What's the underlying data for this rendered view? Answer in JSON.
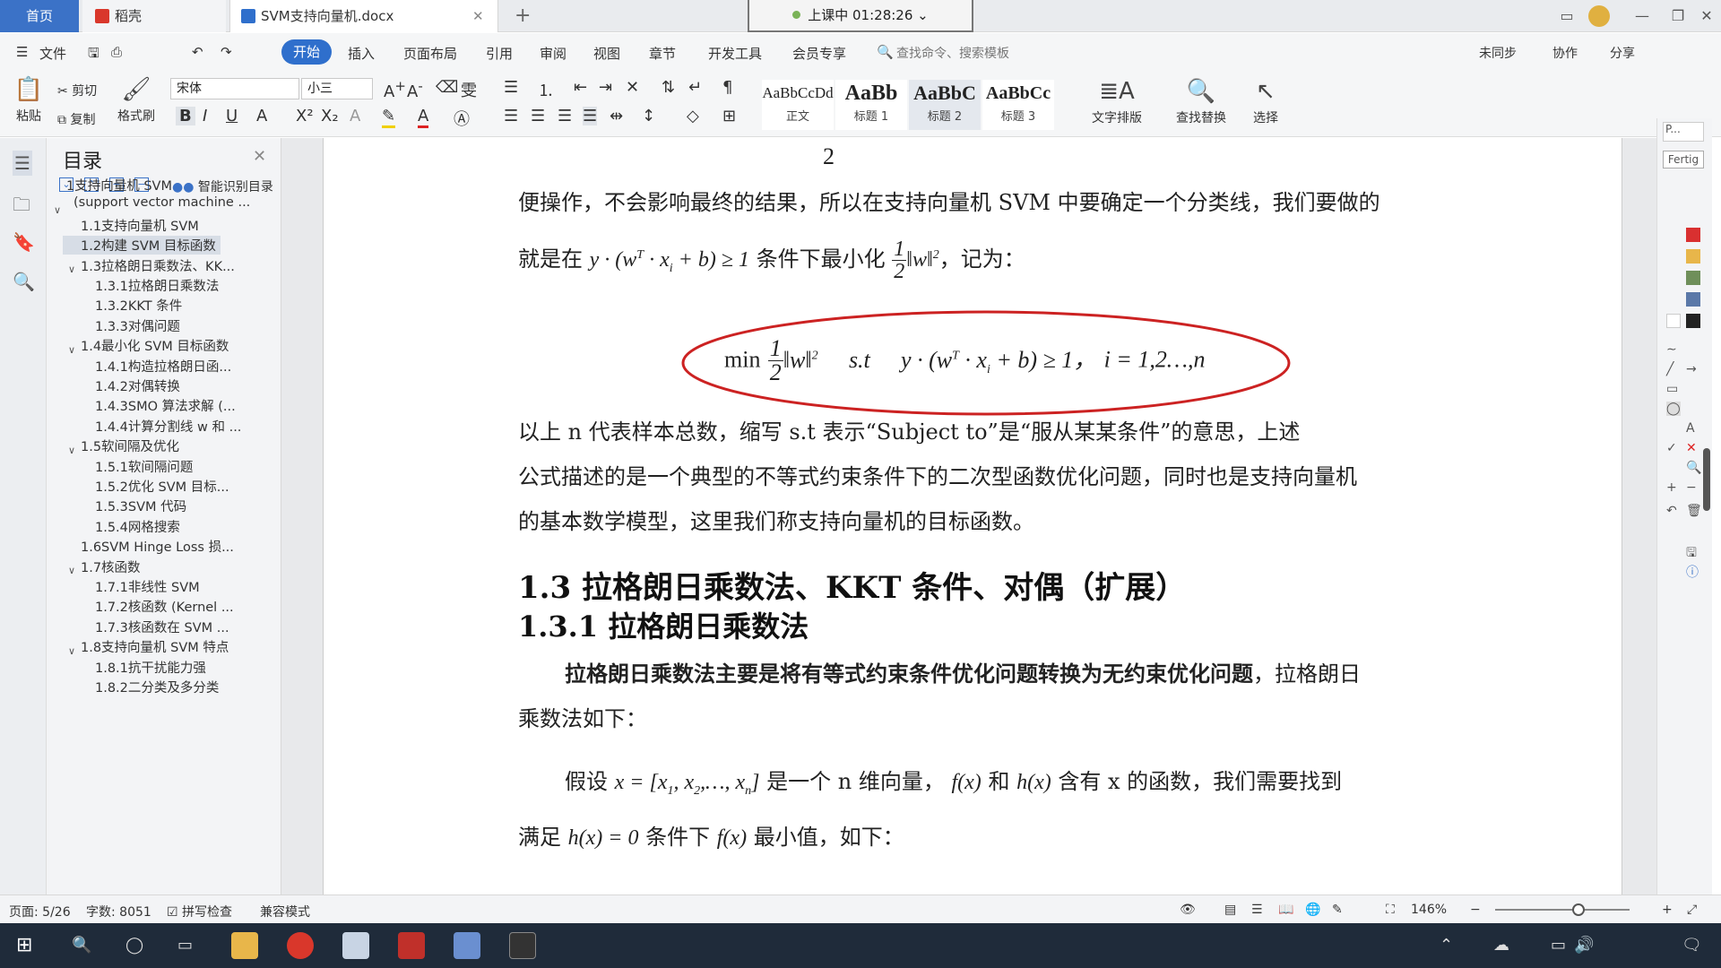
{
  "tabs": {
    "home": "首页",
    "daoke": "稻壳",
    "doc": "SVM支持向量机.docx",
    "add": "+"
  },
  "timer": "上课中 01:28:26",
  "menu": [
    "文件",
    "开始",
    "插入",
    "页面布局",
    "引用",
    "审阅",
    "视图",
    "章节",
    "开发工具",
    "会员专享"
  ],
  "search_placeholder": "查找命令、搜索模板",
  "right_menu": {
    "sync": "未同步",
    "collab": "协作",
    "share": "分享"
  },
  "ribbon": {
    "paste": "粘贴",
    "cut": "剪切",
    "copy": "复制",
    "format_painter": "格式刷",
    "font": "宋体",
    "size": "小三",
    "styles": [
      {
        "preview": "AaBbCcDd",
        "name": "正文"
      },
      {
        "preview": "AaBb",
        "name": "标题 1"
      },
      {
        "preview": "AaBbC",
        "name": "标题 2"
      },
      {
        "preview": "AaBbCc",
        "name": "标题 3"
      }
    ],
    "text_layout": "文字排版",
    "find_replace": "查找替换",
    "select": "选择"
  },
  "toc": {
    "title": "目录",
    "smart": "智能识别目录",
    "items": [
      "1支持向量机 SVM",
      "(support vector machine ...",
      "1.1支持向量机 SVM",
      "1.2构建 SVM 目标函数",
      "1.3拉格朗日乘数法、KK...",
      "1.3.1拉格朗日乘数法",
      "1.3.2KKT 条件",
      "1.3.3对偶问题",
      "1.4最小化 SVM 目标函数",
      "1.4.1构造拉格朗日函...",
      "1.4.2对偶转换",
      "1.4.3SMO 算法求解 (...",
      "1.4.4计算分割线 w 和 ...",
      "1.5软间隔及优化",
      "1.5.1软间隔问题",
      "1.5.2优化 SVM 目标...",
      "1.5.3SVM 代码",
      "1.5.4网格搜索",
      "1.6SVM Hinge Loss 损...",
      "1.7核函数",
      "1.7.1非线性 SVM",
      "1.7.2核函数 (Kernel ...",
      "1.7.3核函数在 SVM ...",
      "1.8支持向量机 SVM 特点",
      "1.8.1抗干扰能力强",
      "1.8.2二分类及多分类"
    ]
  },
  "doc": {
    "p1a": "便操作，不会影响最终的结果，所以在支持向量机 SVM 中要确定一个分类线，我们要做的",
    "p1b_pre": "就是在",
    "p1b_cond": "条件下最小化",
    "p1b_post": "，记为：",
    "formula_min": "min",
    "formula_st": "s.t",
    "formula_i": "i = 1,2…,n",
    "p2a": "以上 n 代表样本总数，缩写 s.t 表示“Subject to”是“服从某某条件”的意思，上述",
    "p2b": "公式描述的是一个典型的不等式约束条件下的二次型函数优化问题，同时也是支持向量机",
    "p2c": "的基本数学模型，这里我们称支持向量机的目标函数。",
    "h13": "1.3  拉格朗日乘数法、KKT 条件、对偶（扩展）",
    "h131": "1.3.1      拉格朗日乘数法",
    "p3a_bold": "拉格朗日乘数法主要是将有等式约束条件优化问题转换为无约束优化问题",
    "p3a_rest": "，拉格朗日",
    "p3b": "乘数法如下：",
    "p4a_pre": "假设",
    "p4a_mid": "是一个 n 维向量，",
    "p4a_and": "和",
    "p4a_post": "含有 x 的函数，我们需要找到",
    "p5_pre": "满足",
    "p5_mid": "条件下",
    "p5_post": "最小值，如下："
  },
  "right_panel": {
    "fertig": "Fertig"
  },
  "status": {
    "page": "页面: 5/26",
    "words": "字数: 8051",
    "spell": "拼写检查",
    "compat": "兼容模式",
    "zoom": "146%"
  },
  "colors": {
    "accent": "#2f6fcc",
    "ellipse": "#cc2222",
    "taskbar": "#1f2b3a"
  }
}
